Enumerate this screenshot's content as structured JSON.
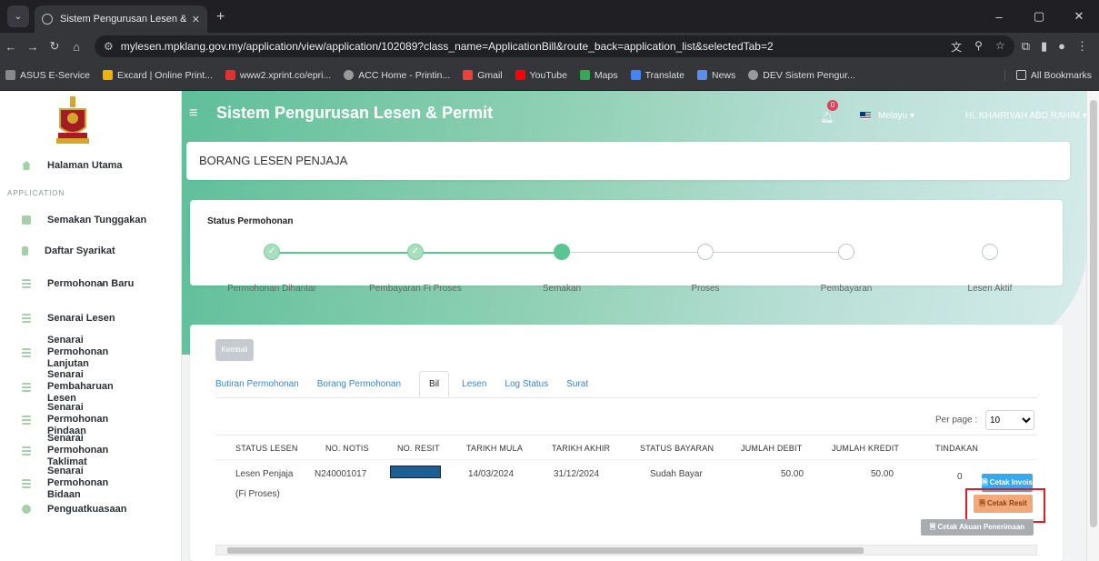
{
  "browser": {
    "tab_title": "Sistem Pengurusan Lesen & Per",
    "url": "mylesen.mpklang.gov.my/application/view/application/102089?class_name=ApplicationBill&route_back=application_list&selectedTab=2",
    "bookmarks": [
      "ASUS E-Service",
      "Excard | Online Print...",
      "www2.xprint.co/epri...",
      "ACC Home - Printin...",
      "Gmail",
      "YouTube",
      "Maps",
      "Translate",
      "News",
      "DEV Sistem Pengur..."
    ],
    "all_bookmarks": "All Bookmarks"
  },
  "sidebar": {
    "home": "Halaman Utama",
    "section": "APPLICATION",
    "items": [
      "Semakan Tunggakan",
      "Daftar Syarikat",
      "Permohonan Baru",
      "Senarai Lesen",
      "Senarai Permohonan Lanjutan",
      "Senarai Pembaharuan Lesen",
      "Senarai Permohonan Pindaan",
      "Senarai Permohonan Taklimat",
      "Senarai Permohonan Bidaan",
      "Penguatkuasaan"
    ]
  },
  "header": {
    "title": "Sistem Pengurusan Lesen & Permit",
    "notification_count": "0",
    "language": "Melayu",
    "user": "Hi, KHAIRIYAH ABD RAHIM"
  },
  "form_title": "BORANG LESEN PENJAJA",
  "status": {
    "title": "Status Permohonan",
    "steps": [
      "Permohonan Dihantar",
      "Pembayaran Fi Proses",
      "Semakan",
      "Proses",
      "Pembayaran",
      "Lesen Aktif"
    ]
  },
  "detail": {
    "back_button": "Kembali",
    "tabs": [
      "Butiran Permohonan",
      "Borang Permohonan",
      "Bil",
      "Lesen",
      "Log Status",
      "Surat"
    ],
    "per_page_label": "Per page :",
    "per_page_value": "10",
    "columns": [
      "STATUS LESEN",
      "NO. NOTIS",
      "NO. RESIT",
      "TARIKH MULA",
      "TARIKH AKHIR",
      "STATUS BAYARAN",
      "JUMLAH DEBIT",
      "JUMLAH KREDIT",
      "TINDAKAN"
    ],
    "row": {
      "status_lesen": "Lesen Penjaja",
      "status_sub": "(Fi Proses)",
      "no_notis": "N240001017",
      "tarikh_mula": "14/03/2024",
      "tarikh_akhir": "31/12/2024",
      "status_bayaran": "Sudah Bayar",
      "jumlah_debit": "50.00",
      "jumlah_kredit": "50.00",
      "tindakan_prefix": "0"
    },
    "actions": {
      "invois": "Cetak Invois",
      "resit": "Cetak Resit",
      "akuan": "Cetak Akuan Penerimaan"
    }
  }
}
